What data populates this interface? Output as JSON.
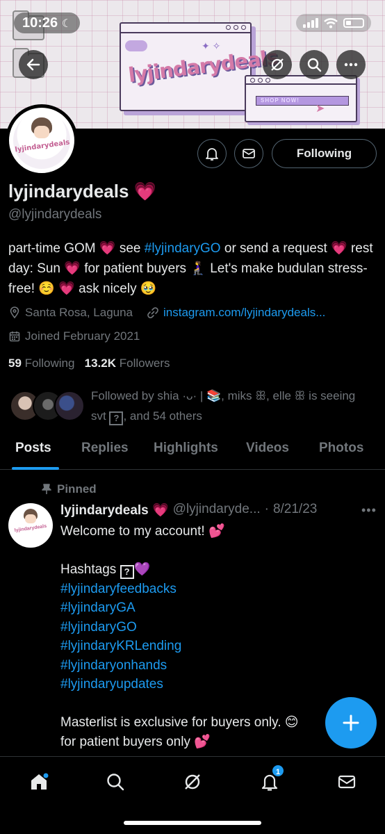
{
  "status_bar": {
    "time": "10:26"
  },
  "banner": {
    "logo": "lyjindarydeals",
    "shop_button": "SHOP NOW!"
  },
  "header": {
    "following_label": "Following"
  },
  "profile": {
    "display_name": "lyjindarydeals 💗",
    "handle": "@lyjindarydeals",
    "avatar_text": "lyjindarydeals",
    "bio": {
      "part1": "part-time GOM 💗 see ",
      "hashtag": "#lyjindaryGO",
      "part2": " or send a request 💗 rest day: Sun 💗 for patient buyers 🧎‍♀️ Let's make budulan stress-free! ☺️ 💗 ask nicely 🥹"
    },
    "location": "Santa Rosa, Laguna",
    "website": "instagram.com/lyjindarydeals...",
    "joined": "Joined February 2021",
    "following_count": "59",
    "following_label": "Following",
    "followers_count": "13.2K",
    "followers_label": "Followers",
    "followed_by": "Followed by shia ·ᴗ· | 📚, miks ꕥ, elle ꕥ is seeing svt",
    "followed_by_box": "?",
    "followed_by_rest": ", and 54 others"
  },
  "tabs": [
    "Posts",
    "Replies",
    "Highlights",
    "Videos",
    "Photos"
  ],
  "post": {
    "pinned_label": "Pinned",
    "author": "lyjindarydeals 💗",
    "handle": "@lyjindaryde...",
    "date": "8/21/23",
    "line1": "Welcome to my account! 💕",
    "hashtags_label": "Hashtags",
    "hashtags_box": "?",
    "hashtags_emoji": "💜",
    "hashtags": [
      "#lyjindaryfeedbacks",
      "#lyjindaryGA",
      "#lyjindaryGO",
      "#lyjindaryKRLending",
      "#lyjindaryonhands",
      "#lyjindaryupdates"
    ],
    "line_master": "Masterlist is exclusive for buyers only. 😊",
    "line_patient": "for patient buyers only 💕"
  },
  "bottom_nav": {
    "notification_badge": "1"
  }
}
